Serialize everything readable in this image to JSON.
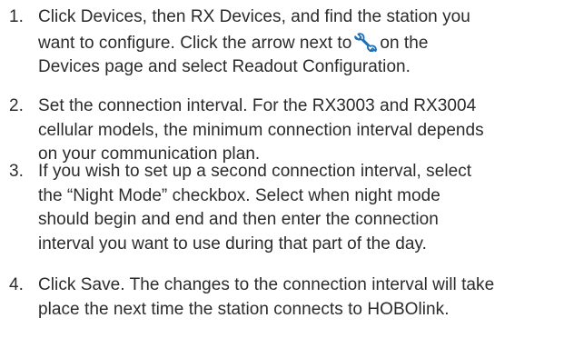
{
  "steps": [
    {
      "number": "1.",
      "lines": [
        "Click Devices, then RX Devices, and find the station you",
        "want to configure. Click the arrow next to",
        "on the",
        "Devices page and select Readout Configuration."
      ],
      "icon": "wrench-icon"
    },
    {
      "number": "2.",
      "lines": [
        "Set the connection interval. For the RX3003 and RX3004",
        "cellular models, the minimum connection interval depends",
        "on your communication plan."
      ]
    },
    {
      "number": "3.",
      "lines": [
        "If you wish to set up a second connection interval, select",
        "the “Night Mode” checkbox. Select when night mode",
        "should begin and end and then enter the connection",
        "interval you want to use during that part of the day."
      ]
    },
    {
      "number": "4.",
      "lines": [
        "Click Save. The changes to the connection interval will take",
        "place the next time the station connects to HOBOlink."
      ]
    }
  ],
  "colors": {
    "text": "#2b2b2b",
    "icon": "#1f6fb5"
  }
}
